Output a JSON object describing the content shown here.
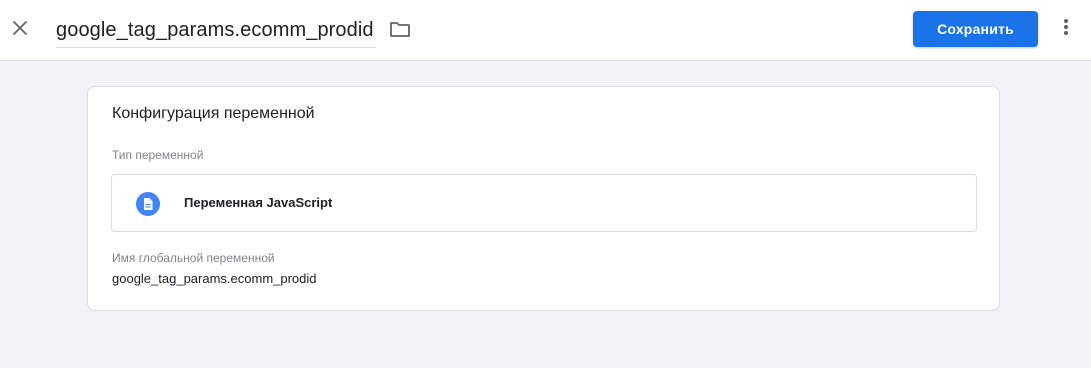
{
  "header": {
    "title": "google_tag_params.ecomm_prodid",
    "save_label": "Сохранить",
    "icons": {
      "close": "close-icon",
      "folder": "folder-icon",
      "more": "more-vert-icon"
    }
  },
  "card": {
    "title": "Конфигурация переменной",
    "type_section_label": "Тип переменной",
    "type_name": "Переменная JavaScript",
    "type_icon": "document-icon",
    "global_name_label": "Имя глобальной переменной",
    "global_name_value": "google_tag_params.ecomm_prodid"
  },
  "colors": {
    "accent": "#1a73e8",
    "type_icon_bg": "#4285f4",
    "background": "#f1f3f4"
  }
}
